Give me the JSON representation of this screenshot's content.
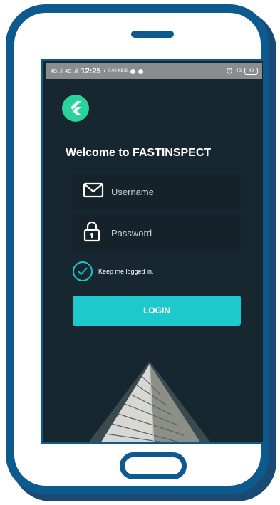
{
  "status_bar": {
    "signal": "4G .ıll 4G .ıll",
    "time": "12:25",
    "indicator": "ʟ",
    "net_speed": "0.00 KB/S",
    "alarm_icon": "alarm-icon",
    "network": "4G",
    "battery": "49"
  },
  "app": {
    "logo_icon": "flutter-logo-icon",
    "welcome": "Welcome to FASTINSPECT"
  },
  "form": {
    "username_placeholder": "Username",
    "password_placeholder": "Password",
    "keep_logged_in": "Keep me logged in.",
    "keep_logged_in_checked": true,
    "login_label": "LOGIN"
  },
  "colors": {
    "frame": "#0c5a8e",
    "screen_bg": "#172730",
    "accent": "#1cc9cb",
    "logo": "#2bd39c"
  }
}
